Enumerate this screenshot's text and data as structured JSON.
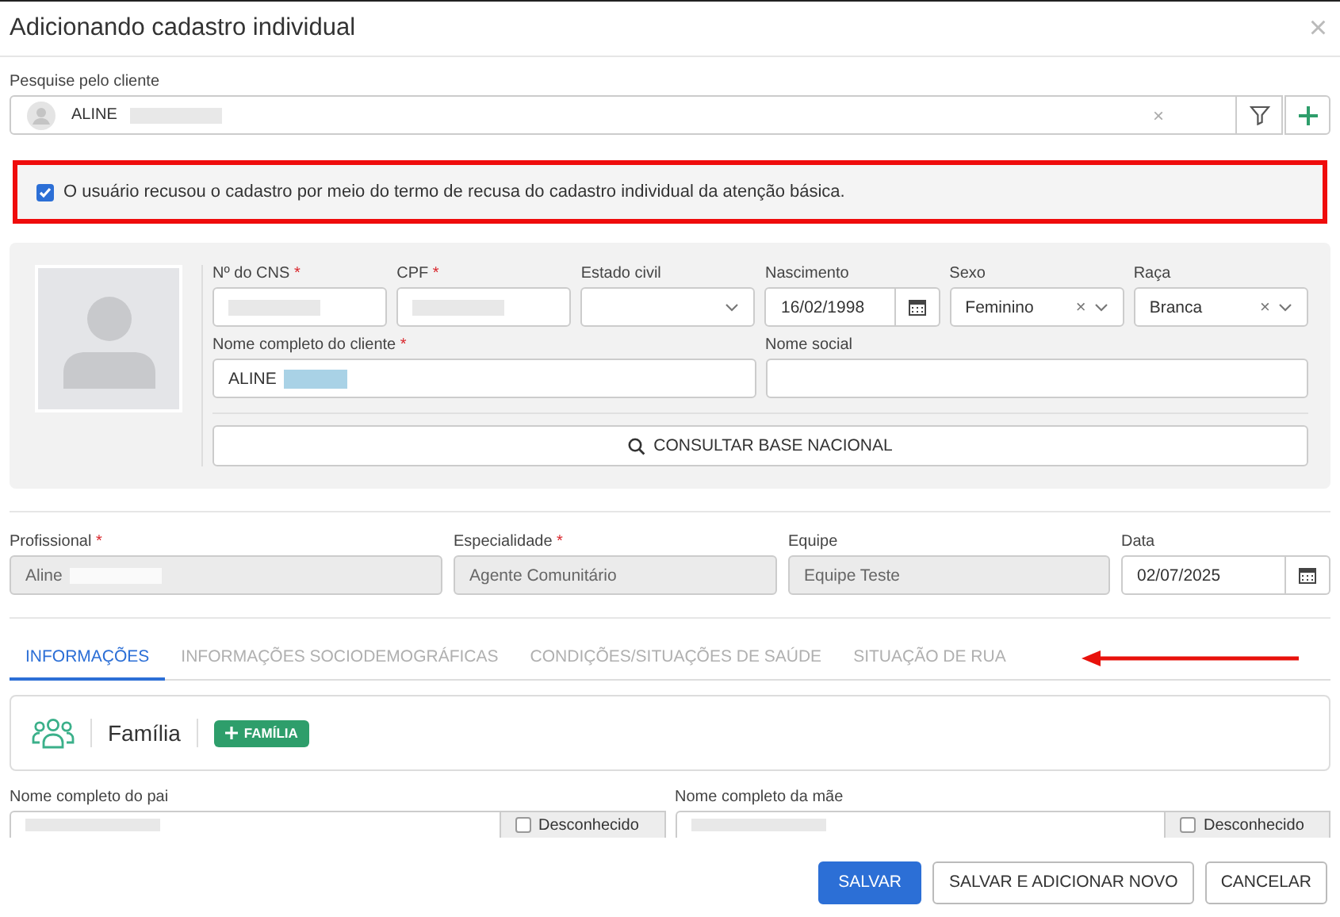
{
  "dialog": {
    "title": "Adicionando cadastro individual",
    "close": "×"
  },
  "client_search": {
    "label": "Pesquise pelo cliente",
    "value": "ALINE",
    "redacted": true,
    "clear": "×"
  },
  "refusal": {
    "checked": true,
    "text": "O usuário recusou o cadastro por meio do termo de recusa do cadastro individual da atenção básica."
  },
  "patient": {
    "row_1": [
      {
        "label": "Nº do CNS",
        "required": "*",
        "kind": "text",
        "redacted": true
      },
      {
        "label": "CPF",
        "required": "*",
        "kind": "text",
        "redacted": true
      },
      {
        "label": "Estado civil",
        "kind": "select"
      },
      {
        "label": "Nascimento",
        "kind": "date",
        "value": "16/02/1998"
      },
      {
        "label": "Sexo",
        "kind": "select",
        "value": "Feminino",
        "clear": "×"
      },
      {
        "label": "Raça",
        "kind": "select",
        "value": "Branca",
        "clear": "×"
      }
    ],
    "row_2": [
      {
        "label": "Nome completo do cliente",
        "required": "*",
        "kind": "text",
        "value": "ALINE",
        "redacted": true,
        "highlighted": true
      },
      {
        "label": "Nome social",
        "kind": "text"
      }
    ],
    "lookup_button": "CONSULTAR BASE NACIONAL"
  },
  "professional": [
    {
      "label": "Profissional",
      "required": "*",
      "kind": "text",
      "disabled": true,
      "value": "Aline",
      "redacted": true
    },
    {
      "label": "Especialidade",
      "required": "*",
      "kind": "text",
      "disabled": true,
      "value": "Agente Comunitário"
    },
    {
      "label": "Equipe",
      "kind": "text",
      "disabled": true,
      "value": "Equipe Teste"
    },
    {
      "label": "Data",
      "kind": "date",
      "disabled": false,
      "value": "02/07/2025"
    }
  ],
  "tabs": [
    {
      "label": "INFORMAÇÕES",
      "selected": true
    },
    {
      "label": "INFORMAÇÕES SOCIODEMOGRÁFICAS",
      "selected": false
    },
    {
      "label": "CONDIÇÕES/SITUAÇÕES DE SAÚDE",
      "selected": false
    },
    {
      "label": "SITUAÇÃO DE RUA",
      "selected": false
    }
  ],
  "family": {
    "title": "Família",
    "button": "FAMÍLIA"
  },
  "parents": [
    {
      "label": "Nome completo do pai",
      "redacted": true,
      "unknown_label": "Desconhecido",
      "unknown_checked": false
    },
    {
      "label": "Nome completo da mãe",
      "redacted": true,
      "unknown_label": "Desconhecido",
      "unknown_checked": false
    }
  ],
  "footer_buttons": [
    {
      "label": "SALVAR",
      "kind": "primary"
    },
    {
      "label": "SALVAR E ADICIONAR NOVO",
      "kind": "default"
    },
    {
      "label": "CANCELAR",
      "kind": "default"
    }
  ]
}
